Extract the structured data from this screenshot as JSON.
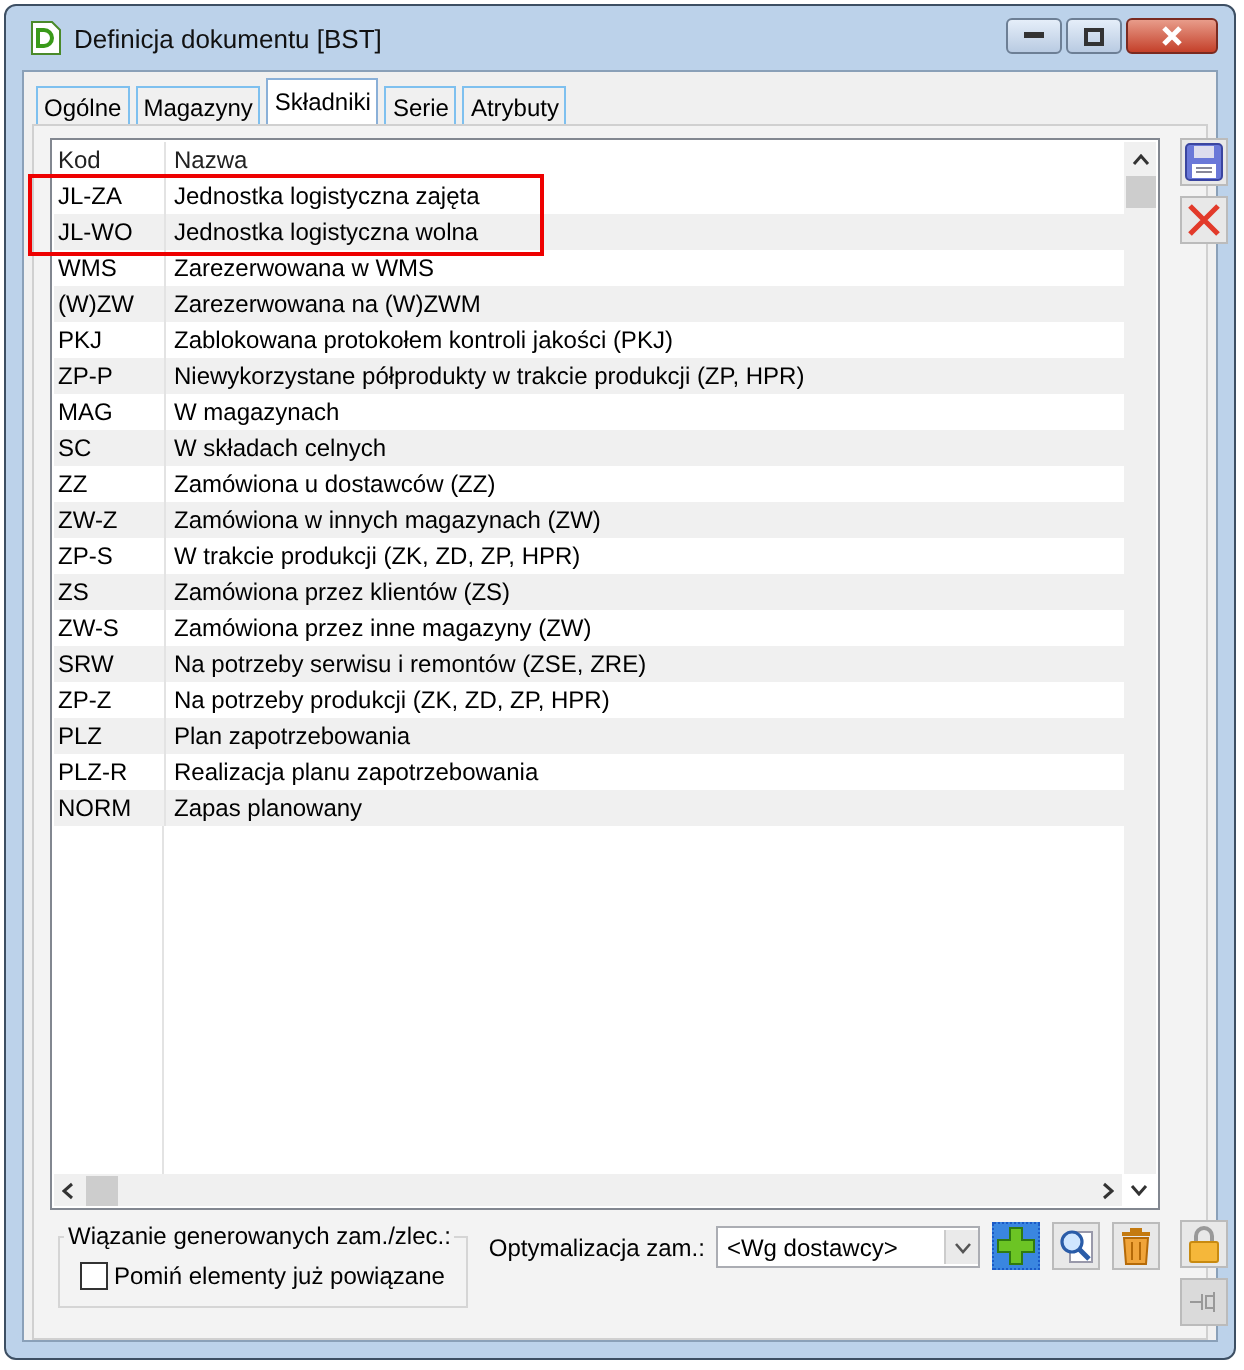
{
  "window": {
    "title": "Definicja dokumentu [BST]"
  },
  "tabs": [
    {
      "label": "Ogólne",
      "selected": false
    },
    {
      "label": "Magazyny",
      "selected": false
    },
    {
      "label": "Składniki",
      "selected": true
    },
    {
      "label": "Serie",
      "selected": false
    },
    {
      "label": "Atrybuty",
      "selected": false
    }
  ],
  "table": {
    "columns": [
      "Kod",
      "Nazwa"
    ],
    "rows": [
      {
        "kod": "JL-ZA",
        "nazwa": "Jednostka logistyczna zajęta"
      },
      {
        "kod": "JL-WO",
        "nazwa": "Jednostka logistyczna wolna"
      },
      {
        "kod": "WMS",
        "nazwa": "Zarezerwowana w WMS"
      },
      {
        "kod": "(W)ZW",
        "nazwa": "Zarezerwowana na (W)ZWM"
      },
      {
        "kod": "PKJ",
        "nazwa": "Zablokowana protokołem kontroli jakości (PKJ)"
      },
      {
        "kod": "ZP-P",
        "nazwa": "Niewykorzystane półprodukty w trakcie produkcji (ZP, HPR)"
      },
      {
        "kod": "MAG",
        "nazwa": "W magazynach"
      },
      {
        "kod": "SC",
        "nazwa": "W składach celnych"
      },
      {
        "kod": "ZZ",
        "nazwa": "Zamówiona u dostawców (ZZ)"
      },
      {
        "kod": "ZW-Z",
        "nazwa": "Zamówiona w innych magazynach (ZW)"
      },
      {
        "kod": "ZP-S",
        "nazwa": "W trakcie produkcji (ZK, ZD, ZP, HPR)"
      },
      {
        "kod": "ZS",
        "nazwa": "Zamówiona przez klientów (ZS)"
      },
      {
        "kod": "ZW-S",
        "nazwa": "Zamówiona przez inne magazyny (ZW)"
      },
      {
        "kod": "SRW",
        "nazwa": "Na potrzeby serwisu i remontów (ZSE, ZRE)"
      },
      {
        "kod": "ZP-Z",
        "nazwa": "Na potrzeby produkcji (ZK, ZD, ZP, HPR)"
      },
      {
        "kod": "PLZ",
        "nazwa": "Plan zapotrzebowania"
      },
      {
        "kod": "PLZ-R",
        "nazwa": "Realizacja planu zapotrzebowania"
      },
      {
        "kod": "NORM",
        "nazwa": "Zapas planowany"
      }
    ]
  },
  "binding_group": {
    "title": "Wiązanie generowanych zam./zlec.:",
    "checkbox": {
      "label": "Pomiń elementy już powiązane",
      "checked": false
    }
  },
  "optimization": {
    "label": "Optymalizacja zam.:",
    "value": "<Wg dostawcy>"
  }
}
